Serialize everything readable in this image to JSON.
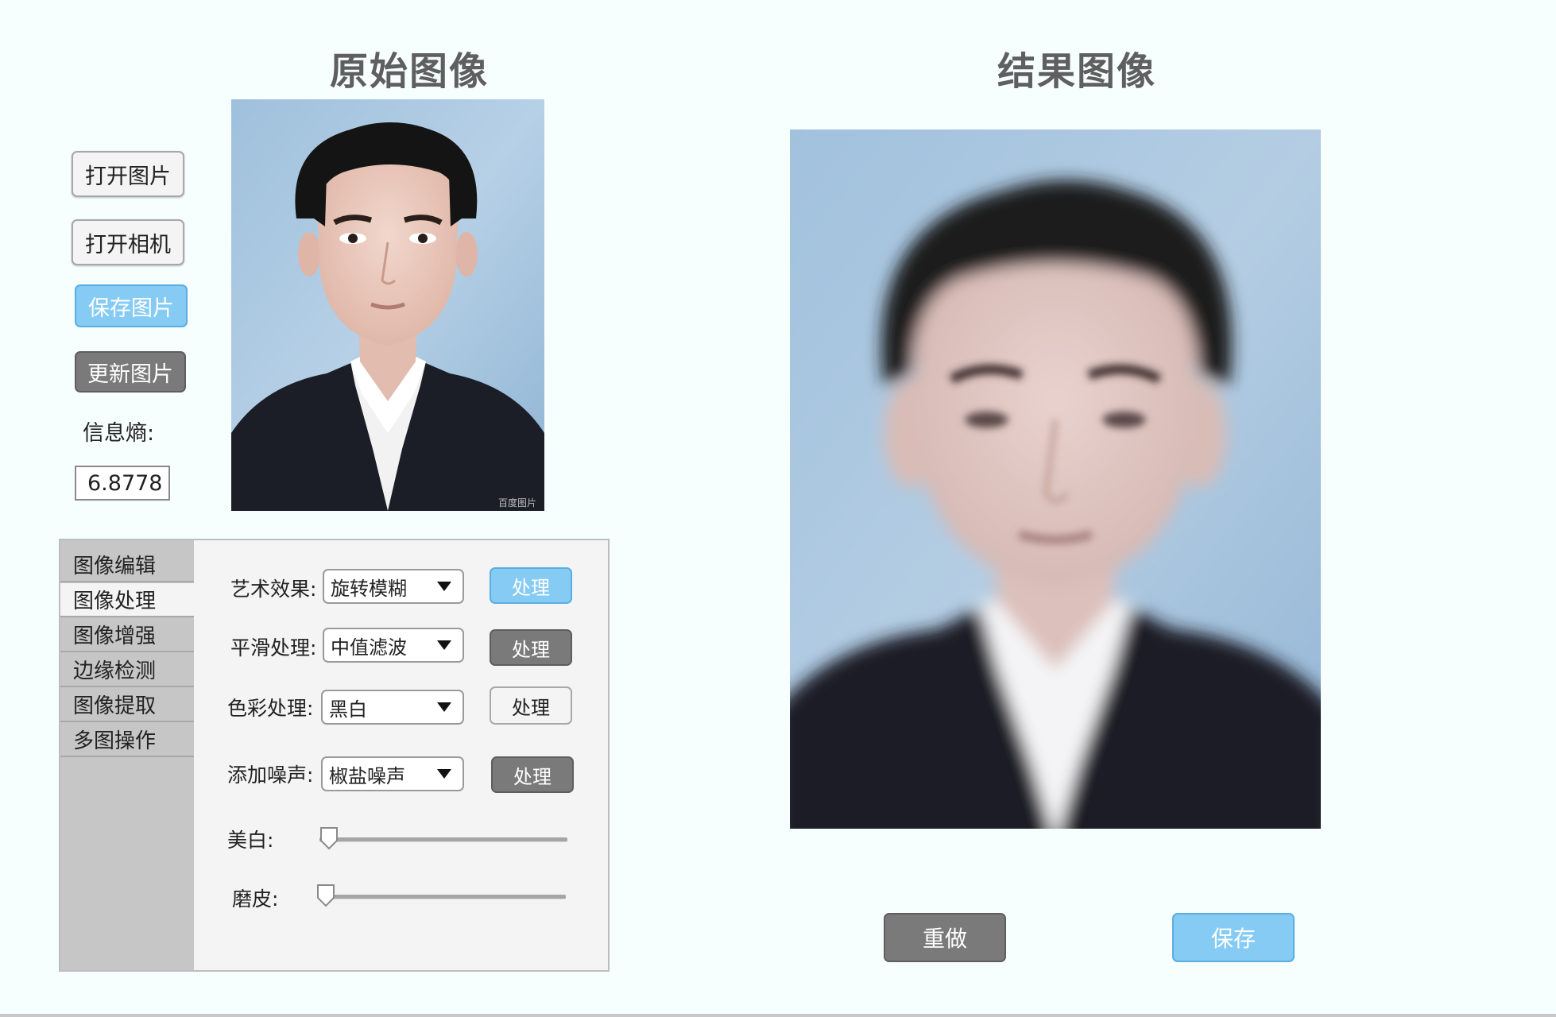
{
  "headings": {
    "original": "原始图像",
    "result": "结果图像"
  },
  "left_buttons": {
    "open_image": "打开图片",
    "open_camera": "打开相机",
    "save_image": "保存图片",
    "update_image": "更新图片"
  },
  "entropy": {
    "label": "信息熵:",
    "value": "6.8778"
  },
  "tabs": [
    {
      "label": "图像编辑",
      "active": false
    },
    {
      "label": "图像处理",
      "active": true
    },
    {
      "label": "图像增强",
      "active": false
    },
    {
      "label": "边缘检测",
      "active": false
    },
    {
      "label": "图像提取",
      "active": false
    },
    {
      "label": "多图操作",
      "active": false
    }
  ],
  "processing": {
    "rows": [
      {
        "label": "艺术效果:",
        "selected": "旋转模糊",
        "button": "处理",
        "button_style": "blue"
      },
      {
        "label": "平滑处理:",
        "selected": "中值滤波",
        "button": "处理",
        "button_style": "gray"
      },
      {
        "label": "色彩处理:",
        "selected": "黑白",
        "button": "处理",
        "button_style": "plain"
      },
      {
        "label": "添加噪声:",
        "selected": "椒盐噪声",
        "button": "处理",
        "button_style": "gray"
      }
    ],
    "sliders": [
      {
        "label": "美白:",
        "value": 0
      },
      {
        "label": "磨皮:",
        "value": 0
      }
    ]
  },
  "bottom_buttons": {
    "redo": "重做",
    "save": "保存"
  },
  "photo": {
    "watermark": "百度图片"
  },
  "colors": {
    "background": "#f7fefe",
    "accent_blue": "#85cbf3",
    "button_gray": "#7a7a7a",
    "photo_bg": "#a6c4df",
    "suit": "#1b1e27"
  }
}
